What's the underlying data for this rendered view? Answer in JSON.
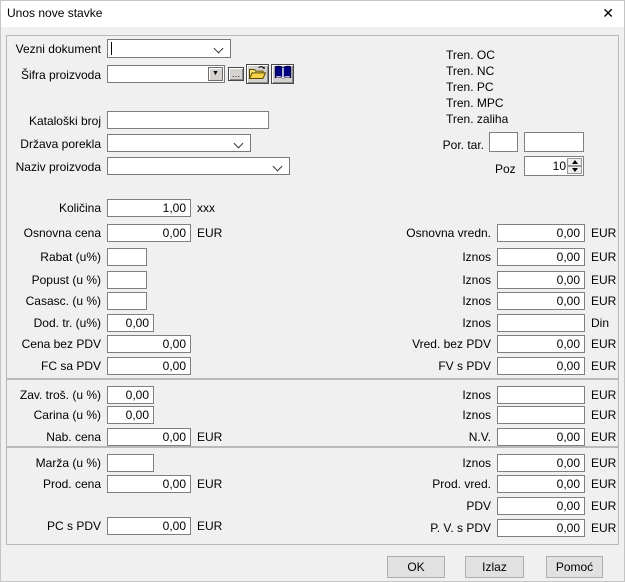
{
  "window": {
    "title": "Unos nove stavke"
  },
  "icons": {
    "close": "✕",
    "dropdown_arrow": "▼",
    "ellipsis": "…"
  },
  "colors": {
    "body_bg": "#f0f0f0",
    "titlebar_bg": "#ffffff",
    "input_border": "#7f7f7f",
    "groupbox_border": "#b9b9b9",
    "button_bg": "#e1e1e1",
    "book_icon": "#00007d",
    "folder_icon": "#f7d24a"
  },
  "header_fields": {
    "vezni_dokument": {
      "label": "Vezni dokument",
      "value": ""
    },
    "sifra_proizvoda": {
      "label": "Šifra proizvoda",
      "value": ""
    },
    "kataloski_broj": {
      "label": "Kataloški broj",
      "value": ""
    },
    "drzava_porekla": {
      "label": "Država porekla",
      "value": ""
    },
    "naziv_proizvoda": {
      "label": "Naziv proizvoda",
      "value": ""
    }
  },
  "info_panel": {
    "tren_labels": [
      "Tren. OC",
      "Tren. NC",
      "Tren. PC",
      "Tren. MPC",
      "Tren. zaliha"
    ],
    "por_tar": {
      "label": "Por. tar.",
      "value1": "",
      "value2": ""
    },
    "poz": {
      "label": "Poz",
      "value": "10"
    }
  },
  "section1": {
    "kolicina": {
      "label": "Količina",
      "value": "1,00",
      "unit": "xxx"
    },
    "left": [
      {
        "label": "Osnovna cena",
        "value": "0,00",
        "unit": "EUR"
      },
      {
        "label": "Rabat (u%)",
        "value": "",
        "unit": ""
      },
      {
        "label": "Popust (u %)",
        "value": "",
        "unit": ""
      },
      {
        "label": "Casasc. (u %)",
        "value": "",
        "unit": ""
      },
      {
        "label": "Dod. tr. (u%)",
        "value": "0,00",
        "unit": ""
      },
      {
        "label": "Cena bez PDV",
        "value": "0,00",
        "unit": ""
      },
      {
        "label": "FC sa PDV",
        "value": "0,00",
        "unit": ""
      }
    ],
    "right": [
      {
        "label": "Osnovna vredn.",
        "value": "0,00",
        "unit": "EUR"
      },
      {
        "label": "Iznos",
        "value": "0,00",
        "unit": "EUR"
      },
      {
        "label": "Iznos",
        "value": "0,00",
        "unit": "EUR"
      },
      {
        "label": "Iznos",
        "value": "0,00",
        "unit": "EUR"
      },
      {
        "label": "Iznos",
        "value": "",
        "unit": "Din"
      },
      {
        "label": "Vred. bez PDV",
        "value": "0,00",
        "unit": "EUR"
      },
      {
        "label": "FV s PDV",
        "value": "0,00",
        "unit": "EUR"
      }
    ]
  },
  "section2": {
    "left": [
      {
        "label": "Zav. troš. (u %)",
        "value": "0,00",
        "unit": ""
      },
      {
        "label": "Carina (u %)",
        "value": "0,00",
        "unit": ""
      },
      {
        "label": "Nab. cena",
        "value": "0,00",
        "unit": "EUR"
      }
    ],
    "right": [
      {
        "label": "Iznos",
        "value": "",
        "unit": "EUR"
      },
      {
        "label": "Iznos",
        "value": "",
        "unit": "EUR"
      },
      {
        "label": "N.V.",
        "value": "0,00",
        "unit": "EUR"
      }
    ]
  },
  "section3": {
    "left": [
      {
        "label": "Marža (u %)",
        "value": "",
        "unit": ""
      },
      {
        "label": "Prod. cena",
        "value": "0,00",
        "unit": "EUR"
      },
      {
        "label": "PC s PDV",
        "value": "0,00",
        "unit": "EUR"
      }
    ],
    "right": [
      {
        "label": "Iznos",
        "value": "0,00",
        "unit": "EUR"
      },
      {
        "label": "Prod. vred.",
        "value": "0,00",
        "unit": "EUR"
      },
      {
        "label": "PDV",
        "value": "0,00",
        "unit": "EUR"
      },
      {
        "label": "P. V. s PDV",
        "value": "0,00",
        "unit": "EUR"
      }
    ]
  },
  "buttons": [
    {
      "label": "OK"
    },
    {
      "label": "Izlaz"
    },
    {
      "label": "Pomoć"
    }
  ]
}
